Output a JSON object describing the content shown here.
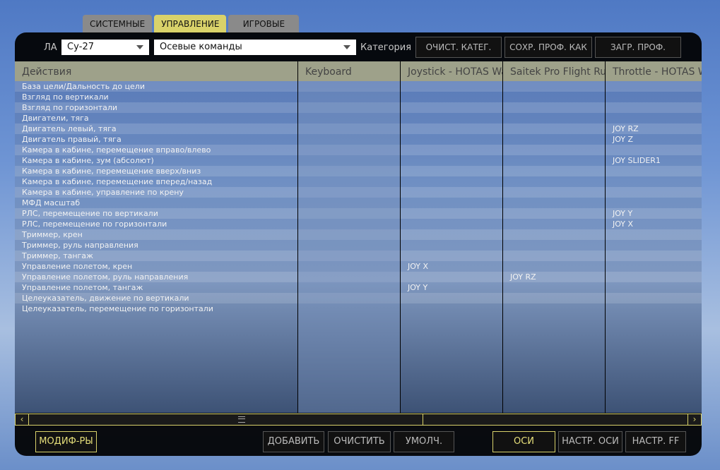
{
  "tabs": [
    {
      "label": "СИСТЕМНЫЕ",
      "active": false
    },
    {
      "label": "УПРАВЛЕНИЕ",
      "active": true
    },
    {
      "label": "ИГРОВЫЕ",
      "active": false
    }
  ],
  "toolbar": {
    "aircraft_label": "ЛА",
    "aircraft_value": "Су-27",
    "category_value": "Осевые команды",
    "category_label": "Категория",
    "clear_category": "ОЧИСТ. КАТЕГ.",
    "save_profile_as": "СОХР. ПРОФ. КАК",
    "load_profile": "ЗАГР. ПРОФ."
  },
  "columns": [
    "Действия",
    "Keyboard",
    "Joystick - HOTAS Warthog",
    "Saitek Pro Flight Rudder Pedals",
    "Throttle - HOTAS Warthog"
  ],
  "rows": [
    {
      "action": "База цели/Дальность до цели",
      "keyboard": "",
      "joystick": "",
      "rudder": "",
      "throttle": ""
    },
    {
      "action": "Взгляд по вертикали",
      "keyboard": "",
      "joystick": "",
      "rudder": "",
      "throttle": ""
    },
    {
      "action": "Взгляд по горизонтали",
      "keyboard": "",
      "joystick": "",
      "rudder": "",
      "throttle": ""
    },
    {
      "action": "Двигатели, тяга",
      "keyboard": "",
      "joystick": "",
      "rudder": "",
      "throttle": ""
    },
    {
      "action": "Двигатель левый, тяга",
      "keyboard": "",
      "joystick": "",
      "rudder": "",
      "throttle": "JOY RZ"
    },
    {
      "action": "Двигатель правый, тяга",
      "keyboard": "",
      "joystick": "",
      "rudder": "",
      "throttle": "JOY Z"
    },
    {
      "action": "Камера в кабине,  перемещение вправо/влево",
      "keyboard": "",
      "joystick": "",
      "rudder": "",
      "throttle": ""
    },
    {
      "action": "Камера в кабине, зум (абсолют)",
      "keyboard": "",
      "joystick": "",
      "rudder": "",
      "throttle": "JOY SLIDER1"
    },
    {
      "action": "Камера в кабине, перемещение вверх/вниз",
      "keyboard": "",
      "joystick": "",
      "rudder": "",
      "throttle": ""
    },
    {
      "action": "Камера в кабине, перемещение вперед/назад",
      "keyboard": "",
      "joystick": "",
      "rudder": "",
      "throttle": ""
    },
    {
      "action": "Камера в кабине, управление по крену",
      "keyboard": "",
      "joystick": "",
      "rudder": "",
      "throttle": ""
    },
    {
      "action": "МФД масштаб",
      "keyboard": "",
      "joystick": "",
      "rudder": "",
      "throttle": ""
    },
    {
      "action": "РЛС, перемещение по вертикали",
      "keyboard": "",
      "joystick": "",
      "rudder": "",
      "throttle": "JOY Y"
    },
    {
      "action": "РЛС, перемещение по горизонтали",
      "keyboard": "",
      "joystick": "",
      "rudder": "",
      "throttle": "JOY X"
    },
    {
      "action": "Триммер, крен",
      "keyboard": "",
      "joystick": "",
      "rudder": "",
      "throttle": ""
    },
    {
      "action": "Триммер, руль направления",
      "keyboard": "",
      "joystick": "",
      "rudder": "",
      "throttle": ""
    },
    {
      "action": "Триммер, тангаж",
      "keyboard": "",
      "joystick": "",
      "rudder": "",
      "throttle": ""
    },
    {
      "action": "Управление полетом, крен",
      "keyboard": "",
      "joystick": "JOY X",
      "rudder": "",
      "throttle": ""
    },
    {
      "action": "Управление полетом, руль направления",
      "keyboard": "",
      "joystick": "",
      "rudder": "JOY RZ",
      "throttle": ""
    },
    {
      "action": "Управление полетом, тангаж",
      "keyboard": "",
      "joystick": "JOY Y",
      "rudder": "",
      "throttle": ""
    },
    {
      "action": "Целеуказатель, движение по вертикали",
      "keyboard": "",
      "joystick": "",
      "rudder": "",
      "throttle": ""
    },
    {
      "action": "Целеуказатель, перемещение по горизонтали",
      "keyboard": "",
      "joystick": "",
      "rudder": "",
      "throttle": ""
    }
  ],
  "footer": {
    "modifiers": "МОДИФ-РЫ",
    "add": "ДОБАВИТЬ",
    "clear": "ОЧИСТИТЬ",
    "default": "УМОЛЧ.",
    "axes": "ОСИ",
    "axis_tune": "НАСТР. ОСИ",
    "ff_tune": "НАСТР. FF"
  }
}
